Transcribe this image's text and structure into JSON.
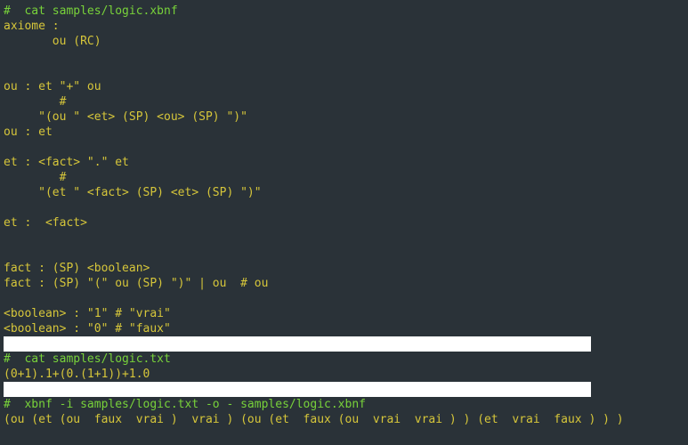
{
  "lines": [
    {
      "cls": "green",
      "text": "#  cat samples/logic.xbnf"
    },
    {
      "cls": "yellow",
      "text": "axiome :"
    },
    {
      "cls": "yellow",
      "text": "       ou (RC)"
    },
    {
      "cls": "yellow",
      "text": ""
    },
    {
      "cls": "yellow",
      "text": ""
    },
    {
      "cls": "yellow",
      "text": "ou : et \"+\" ou"
    },
    {
      "cls": "yellow",
      "text": "        #"
    },
    {
      "cls": "yellow",
      "text": "     \"(ou \" <et> (SP) <ou> (SP) \")\""
    },
    {
      "cls": "yellow",
      "text": "ou : et"
    },
    {
      "cls": "yellow",
      "text": ""
    },
    {
      "cls": "yellow",
      "text": "et : <fact> \".\" et"
    },
    {
      "cls": "yellow",
      "text": "        #"
    },
    {
      "cls": "yellow",
      "text": "     \"(et \" <fact> (SP) <et> (SP) \")\""
    },
    {
      "cls": "yellow",
      "text": ""
    },
    {
      "cls": "yellow",
      "text": "et :  <fact>"
    },
    {
      "cls": "yellow",
      "text": ""
    },
    {
      "cls": "yellow",
      "text": ""
    },
    {
      "cls": "yellow",
      "text": "fact : (SP) <boolean>"
    },
    {
      "cls": "yellow",
      "text": "fact : (SP) \"(\" ou (SP) \")\" | ou  # ou"
    },
    {
      "cls": "yellow",
      "text": ""
    },
    {
      "cls": "yellow",
      "text": "<boolean> : \"1\" # \"vrai\""
    },
    {
      "cls": "yellow",
      "text": "<boolean> : \"0\" # \"faux\""
    },
    {
      "cls": "sep",
      "text": ""
    },
    {
      "cls": "green",
      "text": "#  cat samples/logic.txt"
    },
    {
      "cls": "yellow",
      "text": "(0+1).1+(0.(1+1))+1.0"
    },
    {
      "cls": "sep",
      "text": ""
    },
    {
      "cls": "green",
      "text": "#  xbnf -i samples/logic.txt -o - samples/logic.xbnf"
    },
    {
      "cls": "yellow",
      "text": "(ou (et (ou  faux  vrai )  vrai ) (ou (et  faux (ou  vrai  vrai ) ) (et  vrai  faux ) ) )"
    },
    {
      "cls": "yellow",
      "text": ""
    }
  ]
}
